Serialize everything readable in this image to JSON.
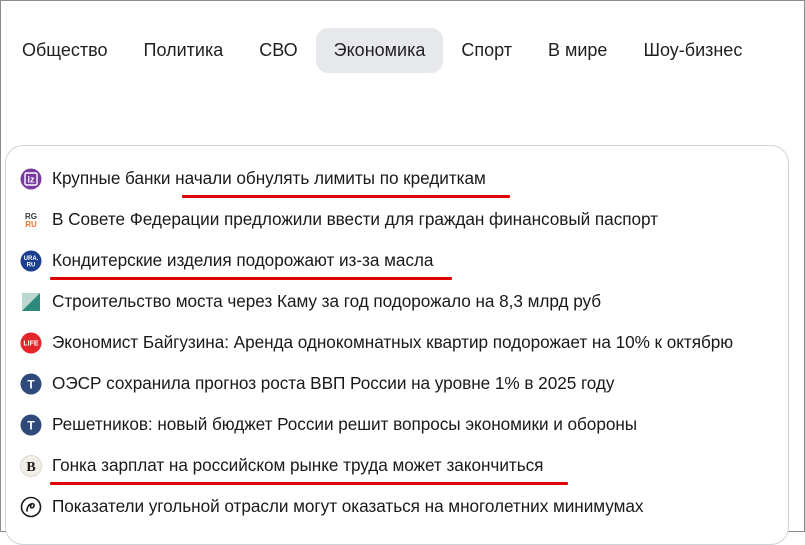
{
  "tabs": [
    {
      "label": "Общество",
      "active": false
    },
    {
      "label": "Политика",
      "active": false
    },
    {
      "label": "СВО",
      "active": false
    },
    {
      "label": "Экономика",
      "active": true
    },
    {
      "label": "Спорт",
      "active": false
    },
    {
      "label": "В мире",
      "active": false
    },
    {
      "label": "Шоу-бизнес",
      "active": false
    }
  ],
  "news": [
    {
      "source_icon": "izvestia-icon",
      "source_mark": "iz",
      "title": "Крупные банки начали обнулять лимиты по кредиткам"
    },
    {
      "source_icon": "rg-icon",
      "source_mark": "RG RU",
      "title": "В Совете Федерации предложили ввести для граждан финансовый паспорт"
    },
    {
      "source_icon": "ura-ru-icon",
      "source_mark": "URA. RU",
      "title": "Кондитерские изделия подорожают из-за масла"
    },
    {
      "source_icon": "triangle-logo-icon",
      "title": "Строительство моста через Каму за год подорожало на 8,3 млрд руб"
    },
    {
      "source_icon": "life-icon",
      "source_mark": "LIFE",
      "title": "Экономист Байгузина: Аренда однокомнатных квартир подорожает на 10% к октябрю"
    },
    {
      "source_icon": "t-circle-icon",
      "source_mark": "T",
      "title": "ОЭСР сохранила прогноз роста ВВП России на уровне 1% в 2025 году"
    },
    {
      "source_icon": "t-circle-icon",
      "source_mark": "T",
      "title": "Решетников: новый бюджет России решит вопросы экономики и обороны"
    },
    {
      "source_icon": "vedomosti-icon",
      "source_mark": "B",
      "title": "Гонка зарплат на российском рынке труда может закончиться"
    },
    {
      "source_icon": "swirl-logo-icon",
      "title": "Показатели угольной отрасли могут оказаться на многолетних минимумах"
    }
  ],
  "colors": {
    "active_tab_bg": "#e7e8ec",
    "underline": "#e00000",
    "izvestia": "#7b3aa0",
    "ura": "#1b3f8f",
    "life": "#e3262b",
    "t_circle": "#2f4a7a",
    "triangle": "#2c8a7a"
  }
}
